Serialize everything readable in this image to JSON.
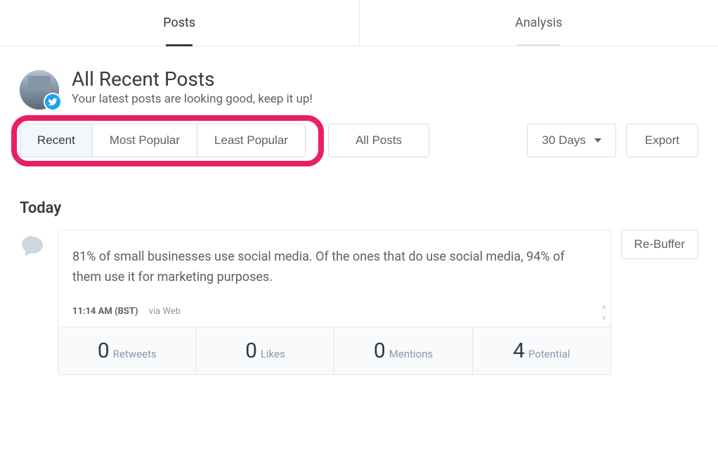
{
  "tabs": {
    "posts": "Posts",
    "analysis": "Analysis"
  },
  "header": {
    "title": "All Recent Posts",
    "subtitle": "Your latest posts are looking good, keep it up!",
    "social_icon": "twitter-icon"
  },
  "filters": {
    "recent": "Recent",
    "most_popular": "Most Popular",
    "least_popular": "Least Popular",
    "all_posts": "All Posts",
    "date_range": "30 Days",
    "export": "Export"
  },
  "section": {
    "today_label": "Today"
  },
  "post": {
    "text": "81% of small businesses use social media. Of the ones that do use social media, 94% of them use it for marketing purposes.",
    "time": "11:14 AM (BST)",
    "via": "via Web",
    "rebuffer": "Re-Buffer",
    "stats": {
      "retweets_value": "0",
      "retweets_label": "Retweets",
      "likes_value": "0",
      "likes_label": "Likes",
      "mentions_value": "0",
      "mentions_label": "Mentions",
      "potential_value": "4",
      "potential_label": "Potential"
    }
  }
}
